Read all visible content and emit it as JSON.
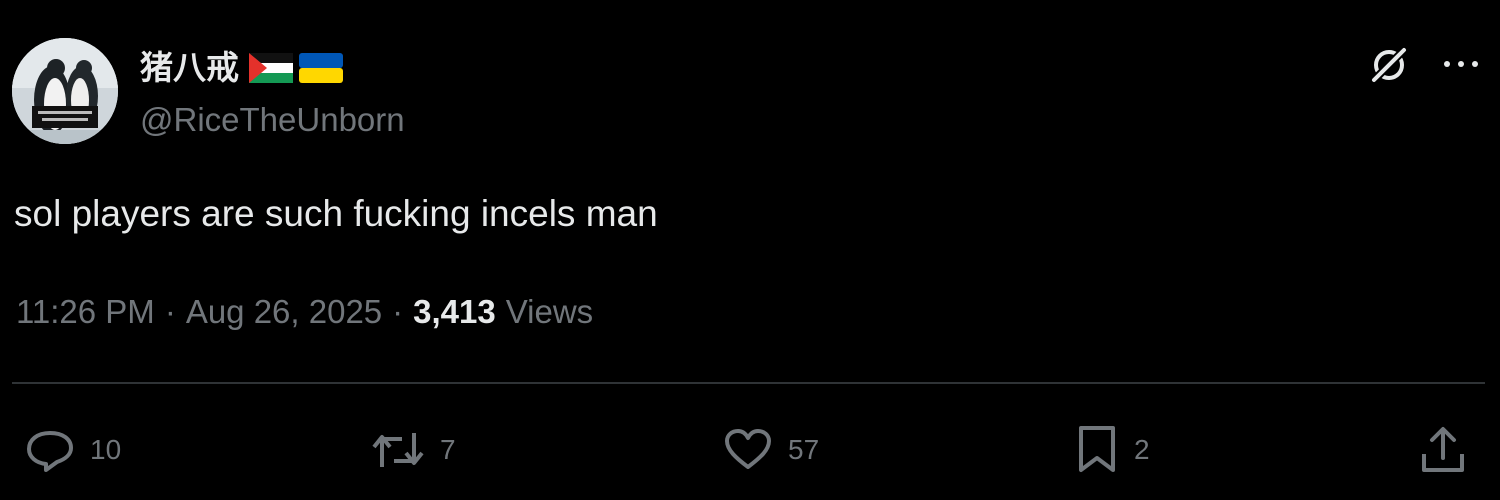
{
  "author": {
    "display_name": "猪八戒",
    "handle": "@RiceTheUnborn",
    "flags": [
      "palestine-flag",
      "ukraine-flag"
    ]
  },
  "tweet": {
    "text": "sol players are such fucking incels man"
  },
  "meta": {
    "time": "11:26 PM",
    "separator": "·",
    "date": "Aug 26, 2025",
    "views_count": "3,413",
    "views_label": "Views"
  },
  "actions": {
    "replies": "10",
    "reposts": "7",
    "likes": "57",
    "bookmarks": "2"
  },
  "icons": [
    "grok-icon",
    "more-icon",
    "reply-icon",
    "repost-icon",
    "like-icon",
    "bookmark-icon",
    "share-icon"
  ],
  "colors": {
    "background": "#000000",
    "primary_text": "#e7e9ea",
    "secondary_text": "#71767b",
    "divider": "#2f3336"
  }
}
